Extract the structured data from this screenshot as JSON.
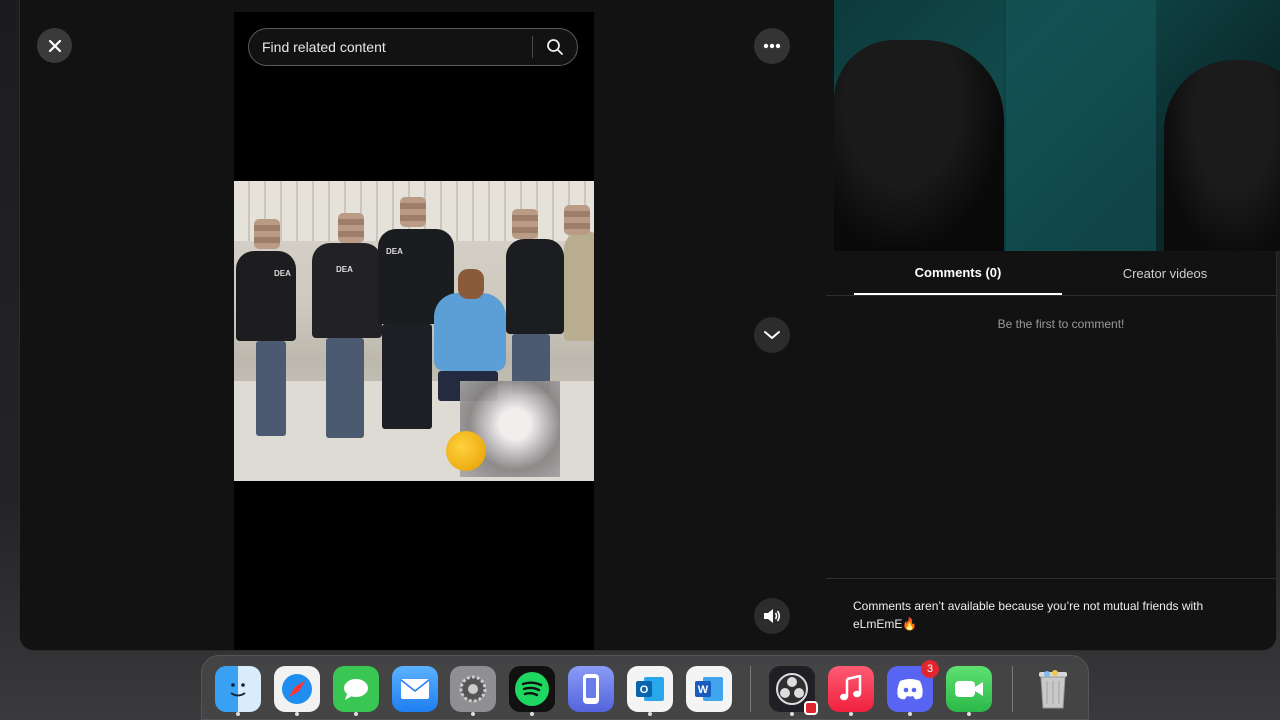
{
  "search": {
    "placeholder": "Find related content"
  },
  "tabs": {
    "comments": "Comments (0)",
    "creator": "Creator videos"
  },
  "comments": {
    "empty_message": "Be the first to comment!",
    "notice": "Comments aren’t available because you’re not mutual friends with eLmEmE🔥"
  },
  "photo": {
    "jacket_text": "DEA"
  },
  "dock": {
    "apps": [
      "Finder",
      "Safari",
      "Messages",
      "Mail",
      "System Settings",
      "Spotify",
      "iPhone Mirroring",
      "Outlook",
      "Word",
      "OBS",
      "Music",
      "Discord",
      "FaceTime",
      "Trash"
    ],
    "discord_badge": "3"
  },
  "colors": {
    "background": "#121212",
    "accent_border": "#ffffff",
    "muted_text": "#9a9a9a",
    "badge": "#e0252f"
  }
}
